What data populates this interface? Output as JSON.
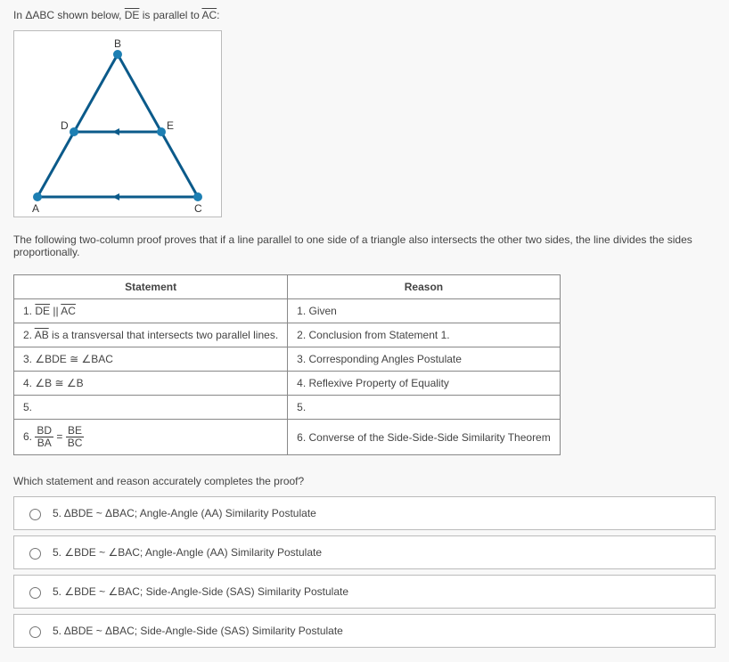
{
  "intro": {
    "prefix": "In ΔABC shown below, ",
    "seg1": "DE",
    "mid": " is parallel to ",
    "seg2": "AC",
    "suffix": ":"
  },
  "figure": {
    "labels": {
      "A": "A",
      "B": "B",
      "C": "C",
      "D": "D",
      "E": "E"
    }
  },
  "proof_intro": "The following two-column proof proves that if a line parallel to one side of a triangle also intersects the other two sides, the line divides the sides proportionally.",
  "table": {
    "head_statement": "Statement",
    "head_reason": "Reason",
    "rows": [
      {
        "num": "1.",
        "st_prefix": "",
        "st_seg1": "DE",
        "st_mid": " || ",
        "st_seg2": "AC",
        "st_suffix": "",
        "reason": "1. Given"
      },
      {
        "num": "2.",
        "st_prefix": "",
        "st_seg1": "AB",
        "st_mid": "",
        "st_seg2": "",
        "st_suffix": " is a transversal that intersects two parallel lines.",
        "reason": "2. Conclusion from Statement 1."
      },
      {
        "num": "3.",
        "st_plain": "∠BDE ≅ ∠BAC",
        "reason": "3. Corresponding Angles Postulate"
      },
      {
        "num": "4.",
        "st_plain": "∠B ≅ ∠B",
        "reason": "4. Reflexive Property of Equality"
      },
      {
        "num": "5.",
        "st_plain": "",
        "reason": "5."
      },
      {
        "num": "6.",
        "frac1_num": "BD",
        "frac1_den": "BA",
        "eq": " = ",
        "frac2_num": "BE",
        "frac2_den": "BC",
        "reason": "6. Converse of the Side-Side-Side Similarity Theorem"
      }
    ]
  },
  "prompt": "Which statement and reason accurately completes the proof?",
  "choices": [
    {
      "prefix": "5. ",
      "text": "ΔBDE ~ ΔBAC; Angle-Angle (AA) Similarity Postulate",
      "has_angles": false
    },
    {
      "prefix": "5. ",
      "a1": "∠BDE",
      "mid": " ~ ",
      "a2": "∠BAC",
      "tail": "; Angle-Angle (AA) Similarity Postulate",
      "has_angles": true
    },
    {
      "prefix": "5. ",
      "a1": "∠BDE",
      "mid": " ~ ",
      "a2": "∠BAC",
      "tail": "; Side-Angle-Side (SAS) Similarity Postulate",
      "has_angles": true
    },
    {
      "prefix": "5. ",
      "text": "ΔBDE ~ ΔBAC; Side-Angle-Side (SAS) Similarity Postulate",
      "has_angles": false
    }
  ]
}
